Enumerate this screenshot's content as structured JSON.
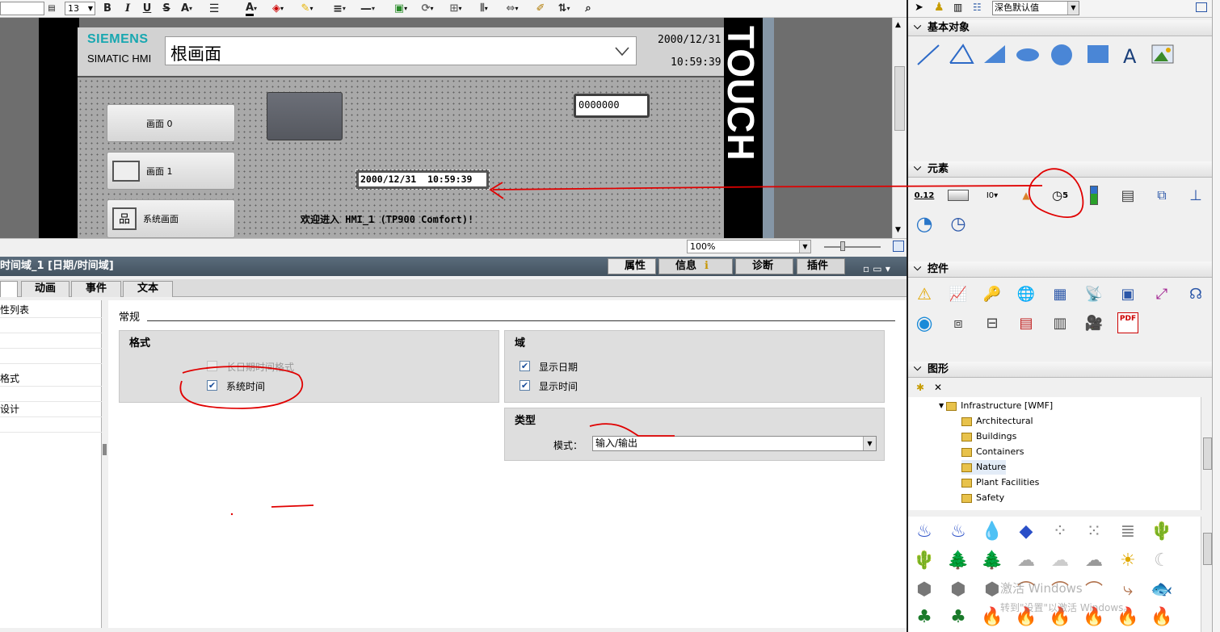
{
  "toolbar": {
    "font_size": "13",
    "bold": "B",
    "italic": "I",
    "underline": "U",
    "strike": "S",
    "superscript": "A",
    "font_color": "A"
  },
  "hmi": {
    "brand": "SIEMENS",
    "brand_sub": "SIMATIC HMI",
    "screen_name": "根画面",
    "date": "2000/12/31",
    "time": "10:59:39",
    "touch_label": "TOUCH",
    "btn_screen0": "画面 0",
    "btn_screen1": "画面 1",
    "btn_system": "系统画面",
    "io_value": "0000000",
    "datetime_field": "2000/12/31  10:59:39",
    "welcome": "欢迎进入 HMI_1 (TP900 Comfort)!"
  },
  "zoom": {
    "value": "100%"
  },
  "properties": {
    "title": "时间域_1 [日期/时间域]",
    "top_tabs": [
      "属性",
      "信息",
      "诊断",
      "插件"
    ],
    "tabs": [
      "动画",
      "事件",
      "文本"
    ],
    "nav": [
      "性列表",
      "格式",
      "设计"
    ],
    "section_general": "常规",
    "format_title": "格式",
    "long_date": "长日期时间格式",
    "system_time": "系统时间",
    "field_title": "域",
    "show_date": "显示日期",
    "show_time": "显示时间",
    "type_title": "类型",
    "mode_label": "模式：",
    "mode_value": "输入/输出"
  },
  "right_panel": {
    "style_select": "深色默认值",
    "basic_objects": "基本对象",
    "elements": "元素",
    "element_value_icon": "0.12",
    "element_clock_digit": "5",
    "controls": "控件",
    "pdf_label": "PDF",
    "graphics": "图形",
    "tree": [
      "Infrastructure [WMF]",
      "Architectural",
      "Buildings",
      "Containers",
      "Nature",
      "Plant Facilities",
      "Safety"
    ]
  },
  "watermark": {
    "line1": "激活 Windows",
    "line2": "转到\"设置\"以激活 Windows。"
  },
  "annotation_color": "#e00000"
}
